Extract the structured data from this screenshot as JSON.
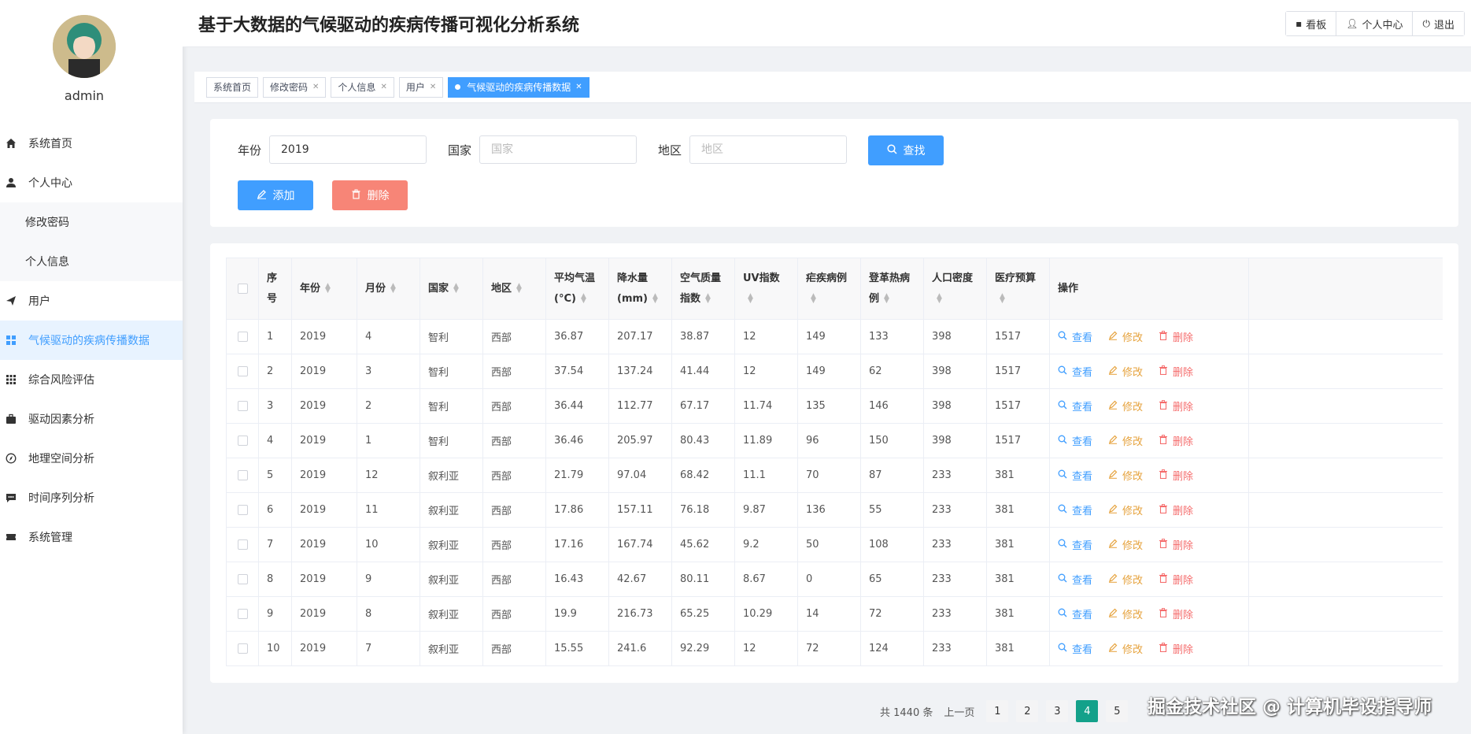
{
  "header": {
    "title": "基于大数据的气候驱动的疾病传播可视化分析系统",
    "actions": [
      {
        "label": "看板",
        "icon": "board-icon"
      },
      {
        "label": "个人中心",
        "icon": "user-icon"
      },
      {
        "label": "退出",
        "icon": "power-icon"
      }
    ]
  },
  "sidebar": {
    "username": "admin",
    "items": [
      {
        "label": "系统首页",
        "icon": "home-icon"
      },
      {
        "label": "个人中心",
        "icon": "user-icon"
      },
      {
        "label": "修改密码"
      },
      {
        "label": "个人信息"
      },
      {
        "label": "用户",
        "icon": "send-icon"
      },
      {
        "label": "气候驱动的疾病传播数据",
        "icon": "grid-icon"
      },
      {
        "label": "综合风险评估",
        "icon": "apps-icon"
      },
      {
        "label": "驱动因素分析",
        "icon": "briefcase-icon"
      },
      {
        "label": "地理空间分析",
        "icon": "compass-icon"
      },
      {
        "label": "时间序列分析",
        "icon": "chat-icon"
      },
      {
        "label": "系统管理",
        "icon": "ticket-icon"
      }
    ]
  },
  "tabs": [
    {
      "label": "系统首页"
    },
    {
      "label": "修改密码"
    },
    {
      "label": "个人信息"
    },
    {
      "label": "用户"
    },
    {
      "label": "气候驱动的疾病传播数据"
    }
  ],
  "search": {
    "year_label": "年份",
    "year_value": "2019",
    "country_label": "国家",
    "country_placeholder": "国家",
    "region_label": "地区",
    "region_placeholder": "地区",
    "search_button": "查找",
    "add_button": "添加",
    "delete_button": "删除"
  },
  "table": {
    "headers": [
      "序号",
      "年份",
      "月份",
      "国家",
      "地区",
      "平均气温(°C)",
      "降水量(mm)",
      "空气质量指数",
      "UV指数",
      "疟疾病例",
      "登革热病例",
      "人口密度",
      "医疗预算",
      "操作"
    ],
    "rows": [
      [
        "1",
        "2019",
        "4",
        "智利",
        "西部",
        "36.87",
        "207.17",
        "38.87",
        "12",
        "149",
        "133",
        "398",
        "1517"
      ],
      [
        "2",
        "2019",
        "3",
        "智利",
        "西部",
        "37.54",
        "137.24",
        "41.44",
        "12",
        "149",
        "62",
        "398",
        "1517"
      ],
      [
        "3",
        "2019",
        "2",
        "智利",
        "西部",
        "36.44",
        "112.77",
        "67.17",
        "11.74",
        "135",
        "146",
        "398",
        "1517"
      ],
      [
        "4",
        "2019",
        "1",
        "智利",
        "西部",
        "36.46",
        "205.97",
        "80.43",
        "11.89",
        "96",
        "150",
        "398",
        "1517"
      ],
      [
        "5",
        "2019",
        "12",
        "叙利亚",
        "西部",
        "21.79",
        "97.04",
        "68.42",
        "11.1",
        "70",
        "87",
        "233",
        "381"
      ],
      [
        "6",
        "2019",
        "11",
        "叙利亚",
        "西部",
        "17.86",
        "157.11",
        "76.18",
        "9.87",
        "136",
        "55",
        "233",
        "381"
      ],
      [
        "7",
        "2019",
        "10",
        "叙利亚",
        "西部",
        "17.16",
        "167.74",
        "45.62",
        "9.2",
        "50",
        "108",
        "233",
        "381"
      ],
      [
        "8",
        "2019",
        "9",
        "叙利亚",
        "西部",
        "16.43",
        "42.67",
        "80.11",
        "8.67",
        "0",
        "65",
        "233",
        "381"
      ],
      [
        "9",
        "2019",
        "8",
        "叙利亚",
        "西部",
        "19.9",
        "216.73",
        "65.25",
        "10.29",
        "14",
        "72",
        "233",
        "381"
      ],
      [
        "10",
        "2019",
        "7",
        "叙利亚",
        "西部",
        "15.55",
        "241.6",
        "92.29",
        "12",
        "72",
        "124",
        "233",
        "381"
      ]
    ],
    "ops": {
      "view": "查看",
      "edit": "修改",
      "delete": "删除"
    }
  },
  "pagination": {
    "total": "共 1440 条",
    "prev": "上一页",
    "pages": [
      "1",
      "2",
      "3",
      "4",
      "5"
    ],
    "current": "4"
  },
  "watermark": "掘金技术社区 @ 计算机毕设指导师",
  "colors": {
    "primary": "#409eff",
    "danger": "#f78577",
    "warning": "#e6a23c",
    "active_page": "#13a18a"
  }
}
